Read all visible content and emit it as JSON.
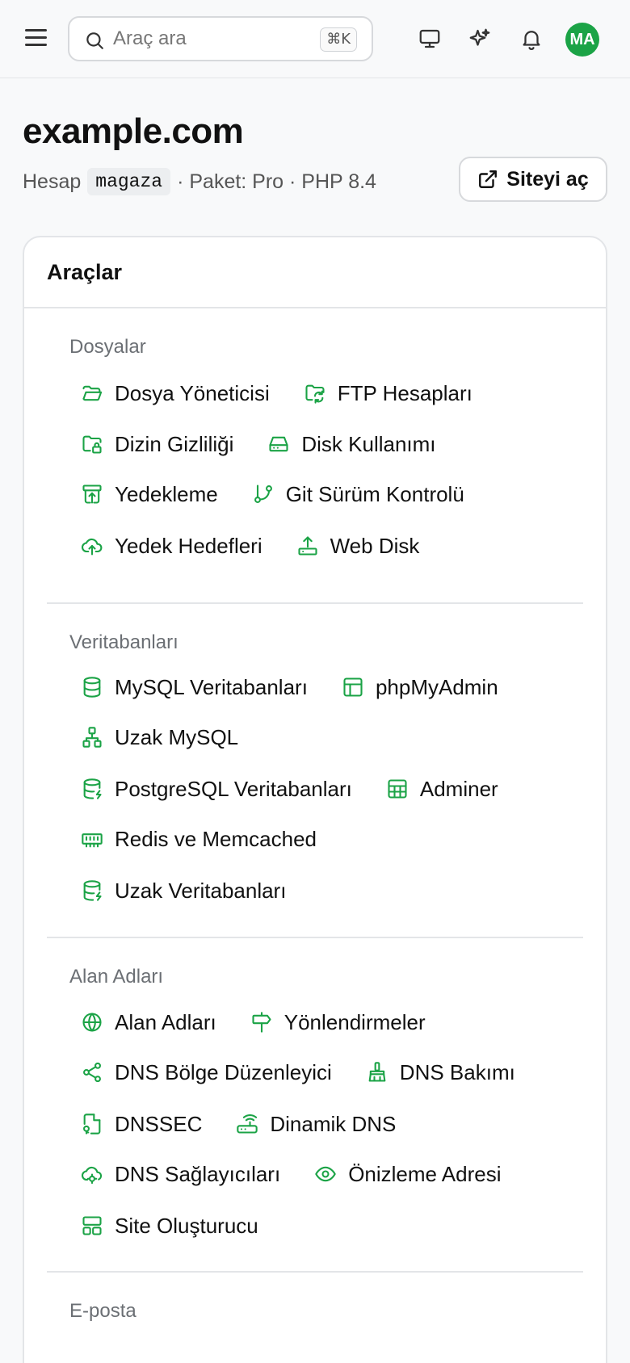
{
  "topbar": {
    "search": {
      "placeholder": "Araç ara",
      "shortcut": "⌘K"
    },
    "avatar_initials": "MA",
    "icons": [
      "menu-icon",
      "search-icon",
      "monitor-icon",
      "sparkles-icon",
      "bell-icon"
    ]
  },
  "site": {
    "domain": "example.com",
    "account_label": "Hesap",
    "account": "magaza",
    "plan_text": "· Paket: Pro · PHP 8.4",
    "open_button": "Siteyi aç"
  },
  "tools": {
    "title": "Araçlar",
    "accent_color": "#1ba346",
    "sections": [
      {
        "title": "Dosyalar",
        "rows": [
          [
            {
              "label": "Dosya Yöneticisi",
              "icon": "folder-open-icon"
            },
            {
              "label": "FTP Hesapları",
              "icon": "folder-sync-icon"
            }
          ],
          [
            {
              "label": "Dizin Gizliliği",
              "icon": "folder-lock-icon"
            },
            {
              "label": "Disk Kullanımı",
              "icon": "hard-drive-icon"
            }
          ],
          [
            {
              "label": "Yedekleme",
              "icon": "archive-restore-icon"
            },
            {
              "label": "Git Sürüm Kontrolü",
              "icon": "git-branch-icon"
            }
          ],
          [
            {
              "label": "Yedek Hedefleri",
              "icon": "cloud-upload-icon"
            },
            {
              "label": "Web Disk",
              "icon": "upload-tray-icon"
            }
          ]
        ]
      },
      {
        "title": "Veritabanları",
        "rows": [
          [
            {
              "label": "MySQL Veritabanları",
              "icon": "database-icon"
            },
            {
              "label": "phpMyAdmin",
              "icon": "table-icon"
            }
          ],
          [
            {
              "label": "Uzak MySQL",
              "icon": "network-icon"
            }
          ],
          [
            {
              "label": "PostgreSQL Veritabanları",
              "icon": "database-zap-icon"
            },
            {
              "label": "Adminer",
              "icon": "sheet-icon"
            }
          ],
          [
            {
              "label": "Redis ve Memcached",
              "icon": "memory-stick-icon"
            }
          ],
          [
            {
              "label": "Uzak Veritabanları",
              "icon": "database-zap-icon"
            }
          ]
        ]
      },
      {
        "title": "Alan Adları",
        "rows": [
          [
            {
              "label": "Alan Adları",
              "icon": "globe-icon"
            },
            {
              "label": "Yönlendirmeler",
              "icon": "signpost-icon"
            }
          ],
          [
            {
              "label": "DNS Bölge Düzenleyici",
              "icon": "share-nodes-icon"
            },
            {
              "label": "DNS Bakımı",
              "icon": "brush-icon"
            }
          ],
          [
            {
              "label": "DNSSEC",
              "icon": "file-key-icon"
            },
            {
              "label": "Dinamik DNS",
              "icon": "router-icon"
            }
          ],
          [
            {
              "label": "DNS Sağlayıcıları",
              "icon": "cloud-cog-icon"
            },
            {
              "label": "Önizleme Adresi",
              "icon": "eye-icon"
            }
          ],
          [
            {
              "label": "Site Oluşturucu",
              "icon": "layout-icon"
            }
          ]
        ]
      },
      {
        "title": "E-posta",
        "rows": []
      }
    ]
  }
}
